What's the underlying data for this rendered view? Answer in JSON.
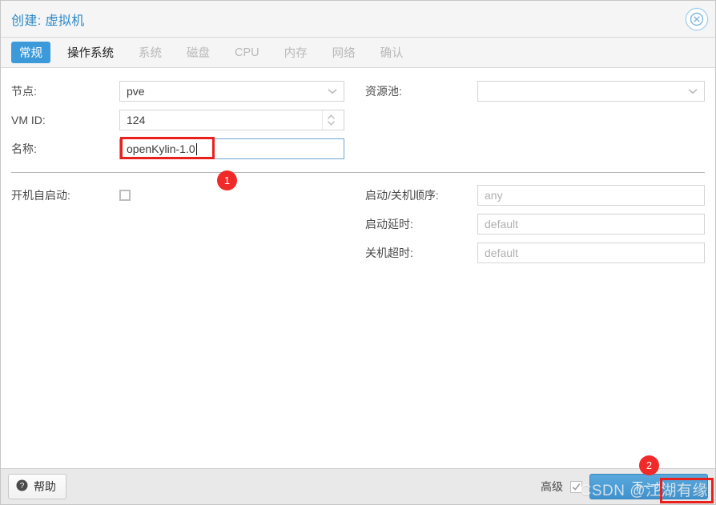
{
  "window": {
    "title": "创建: 虚拟机",
    "close_icon": "close-circle-icon"
  },
  "tabs": [
    {
      "label": "常规",
      "state": "active"
    },
    {
      "label": "操作系统",
      "state": "enabled"
    },
    {
      "label": "系统",
      "state": "disabled"
    },
    {
      "label": "磁盘",
      "state": "disabled"
    },
    {
      "label": "CPU",
      "state": "disabled"
    },
    {
      "label": "内存",
      "state": "disabled"
    },
    {
      "label": "网络",
      "state": "disabled"
    },
    {
      "label": "确认",
      "state": "disabled"
    }
  ],
  "form": {
    "node": {
      "label": "节点:",
      "value": "pve",
      "icon": "chevron-down-icon"
    },
    "vmid": {
      "label": "VM ID:",
      "value": "124",
      "icon": "spinner-updown-icon"
    },
    "name": {
      "label": "名称:",
      "value": "openKylin-1.0",
      "focused": true
    },
    "pool": {
      "label": "资源池:",
      "value": "",
      "placeholder": "",
      "icon": "chevron-down-icon"
    },
    "autostart": {
      "label": "开机自启动:",
      "checked": false
    },
    "start_order": {
      "label": "启动/关机顺序:",
      "value": "",
      "placeholder": "any"
    },
    "startup_delay": {
      "label": "启动延时:",
      "value": "",
      "placeholder": "default"
    },
    "shutdown_timeout": {
      "label": "关机超时:",
      "value": "",
      "placeholder": "default"
    }
  },
  "footer": {
    "help_label": "帮助",
    "help_icon": "question-circle-icon",
    "advanced_label": "高级",
    "advanced_checked": true,
    "next_label": "下一步"
  },
  "annotations": {
    "badge1": "1",
    "badge2": "2",
    "watermark": "CSDN @江湖有缘"
  },
  "colors": {
    "accent": "#3c9ada",
    "title": "#2b88c8",
    "annotation": "#e8211c",
    "footer_bg": "#e9e9e9"
  }
}
